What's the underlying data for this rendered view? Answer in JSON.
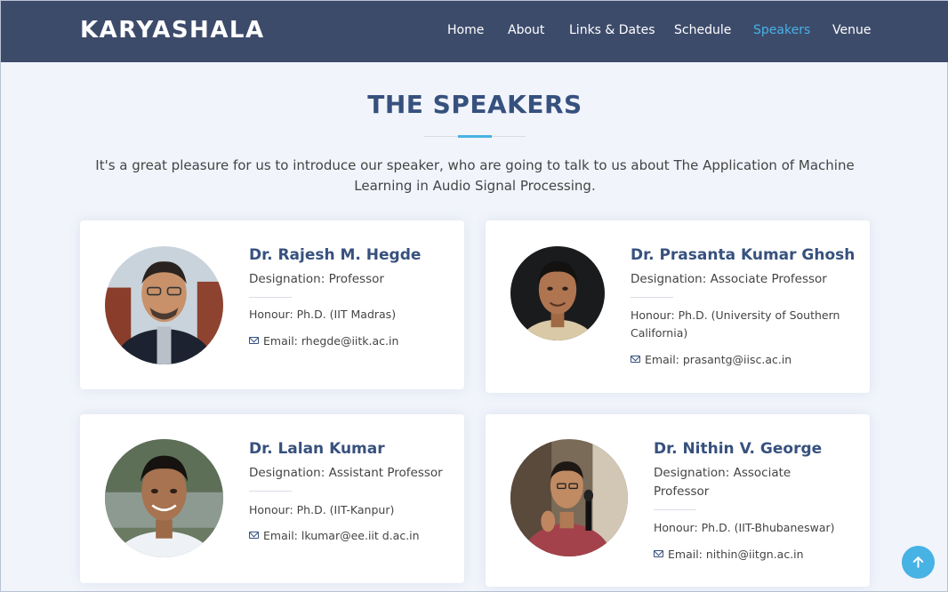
{
  "header": {
    "logo": "KARYASHALA",
    "nav": [
      {
        "label": "Home",
        "active": false
      },
      {
        "label": "About",
        "active": false
      },
      {
        "label": "Links & Dates",
        "active": false
      },
      {
        "label": "Schedule",
        "active": false
      },
      {
        "label": "Speakers",
        "active": true
      },
      {
        "label": "Venue",
        "active": false
      }
    ]
  },
  "section": {
    "title": "THE SPEAKERS",
    "intro": "It's a great pleasure for us to introduce our speaker, who are going to talk to us about The Application of Machine Learning in Audio Signal Processing."
  },
  "speakers": [
    {
      "name": "Dr. Rajesh M. Hegde",
      "designation": "Designation: Professor",
      "honour": "Honour: Ph.D. (IIT Madras)",
      "email": "Email: rhegde@iitk.ac.in"
    },
    {
      "name": "Dr. Prasanta Kumar Ghosh",
      "designation": "Designation: Associate Professor",
      "honour": "Honour: Ph.D. (University of Southern California)",
      "email": "Email: prasantg@iisc.ac.in"
    },
    {
      "name": "Dr. Lalan Kumar",
      "designation": "Designation: Assistant Professor",
      "honour": "Honour: Ph.D. (IIT-Kanpur)",
      "email": "Email: lkumar@ee.iit d.ac.in"
    },
    {
      "name": "Dr. Nithin V. George",
      "designation": "Designation: Associate Professor",
      "honour": "Honour: Ph.D. (IIT-Bhubaneswar)",
      "email": "Email: nithin@iitgn.ac.in"
    }
  ],
  "colors": {
    "header_bg": "#3d4b6b",
    "accent": "#47b2e4",
    "title": "#37517e",
    "page_bg": "#f1f4fb"
  },
  "icons": {
    "email": "envelope-icon",
    "back_to_top": "arrow-up-icon"
  }
}
